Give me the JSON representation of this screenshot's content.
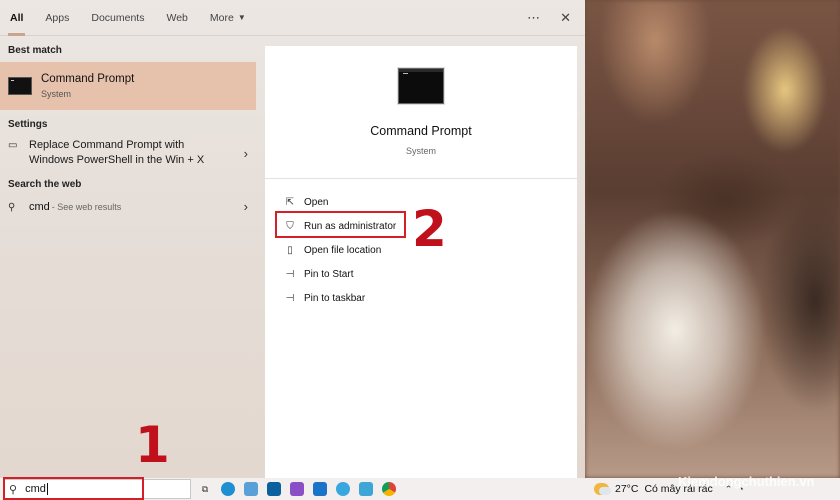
{
  "tabs": [
    "All",
    "Apps",
    "Documents",
    "Web",
    "More"
  ],
  "tab_icons": {
    "more_options": "⋯",
    "close": "✕"
  },
  "best_match": {
    "label": "Best match",
    "title": "Command Prompt",
    "subtitle": "System"
  },
  "settings": {
    "label": "Settings",
    "item": "Replace Command Prompt with Windows PowerShell in the Win + X"
  },
  "search_web": {
    "label": "Search the web",
    "query": "cmd",
    "suffix": "- See web results"
  },
  "detail": {
    "title": "Command Prompt",
    "subtitle": "System",
    "actions": [
      {
        "label": "Open",
        "icon": "open-icon"
      },
      {
        "label": "Run as administrator",
        "icon": "shield-icon"
      },
      {
        "label": "Open file location",
        "icon": "file-location-icon"
      },
      {
        "label": "Pin to Start",
        "icon": "pin-icon"
      },
      {
        "label": "Pin to taskbar",
        "icon": "pin-icon"
      }
    ]
  },
  "annotations": {
    "step1": "1",
    "step2": "2"
  },
  "taskbar": {
    "search_value": "cmd",
    "weather_temp": "27°C",
    "weather_text": "Có mây rải rác"
  },
  "watermark": "Kiemdongchuthien.vn",
  "colors": {
    "highlight_red": "#d31f26",
    "step_red": "#c0101c",
    "best_match_bg": "#e6c2ac"
  }
}
